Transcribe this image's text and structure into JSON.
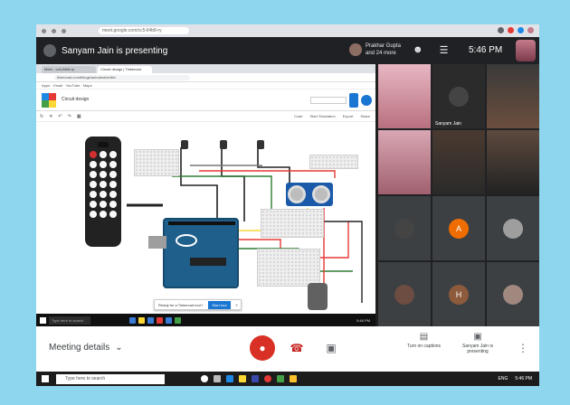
{
  "outer_browser": {
    "url": "meet.google.com/cc5-ll4b8-ry"
  },
  "meet": {
    "presenter_label": "Sanyam Jain is presenting",
    "joined_text": "Prakhar Gupta and 24 more",
    "clock": "5:46 PM",
    "meeting_details": "Meeting details",
    "turn_on_captions": "Turn on captions",
    "presenting_label": "Sanyam Jain is presenting"
  },
  "shared": {
    "tabs": [
      "Meet - cc5-ll4b8-ry",
      "Circuit design | Tinkercad"
    ],
    "url": "tinkercad.com/things/autodesk/editel",
    "bookmarks": "Apps · Gmail · YouTube · Maps",
    "title": "Circuit design",
    "tools_right": [
      "Code",
      "Start Simulation",
      "Export",
      "Share"
    ],
    "tooltip_text": "Ready for a Tinkercad tour?",
    "tooltip_button": "Start tour",
    "taskbar_search": "Type here to search",
    "taskbar_time": "5:46 PM"
  },
  "participants": [
    {
      "name": "",
      "initial": "",
      "kind": "video-pink"
    },
    {
      "name": "Sanyam Jain",
      "initial": "",
      "kind": "video-dark"
    },
    {
      "name": "",
      "initial": "",
      "kind": "video-person"
    },
    {
      "name": "",
      "initial": "",
      "kind": "video-pink2"
    },
    {
      "name": "",
      "initial": "",
      "kind": "video-person2"
    },
    {
      "name": "",
      "initial": "",
      "kind": "video-person3"
    },
    {
      "name": "",
      "initial": "",
      "kind": "avatar-dark"
    },
    {
      "name": "",
      "initial": "A",
      "kind": "avatar-orange"
    },
    {
      "name": "",
      "initial": "",
      "kind": "avatar-gray"
    },
    {
      "name": "",
      "initial": "",
      "kind": "avatar-brown"
    },
    {
      "name": "",
      "initial": "H",
      "kind": "avatar-brown2"
    },
    {
      "name": "",
      "initial": "",
      "kind": "avatar-brown3"
    }
  ],
  "taskbar": {
    "search": "Type here to search",
    "time": "5:46 PM",
    "lang": "ENG"
  },
  "colors": {
    "background": "#8ed6ee",
    "end_call": "#d93025",
    "arduino": "#1f5f8b"
  }
}
